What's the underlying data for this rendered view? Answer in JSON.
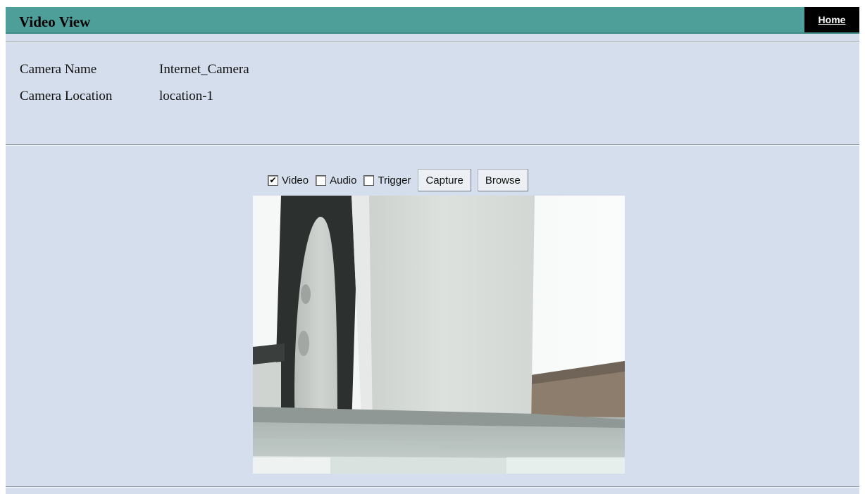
{
  "header": {
    "title": "Video View",
    "home_label": "Home"
  },
  "camera_info": {
    "name_label": "Camera Name",
    "name_value": "Internet_Camera",
    "location_label": "Camera Location",
    "location_value": "location-1"
  },
  "controls": {
    "video": {
      "label": "Video",
      "checked": true
    },
    "audio": {
      "label": "Audio",
      "checked": false
    },
    "trigger": {
      "label": "Trigger",
      "checked": false
    },
    "capture_label": "Capture",
    "browse_label": "Browse"
  }
}
